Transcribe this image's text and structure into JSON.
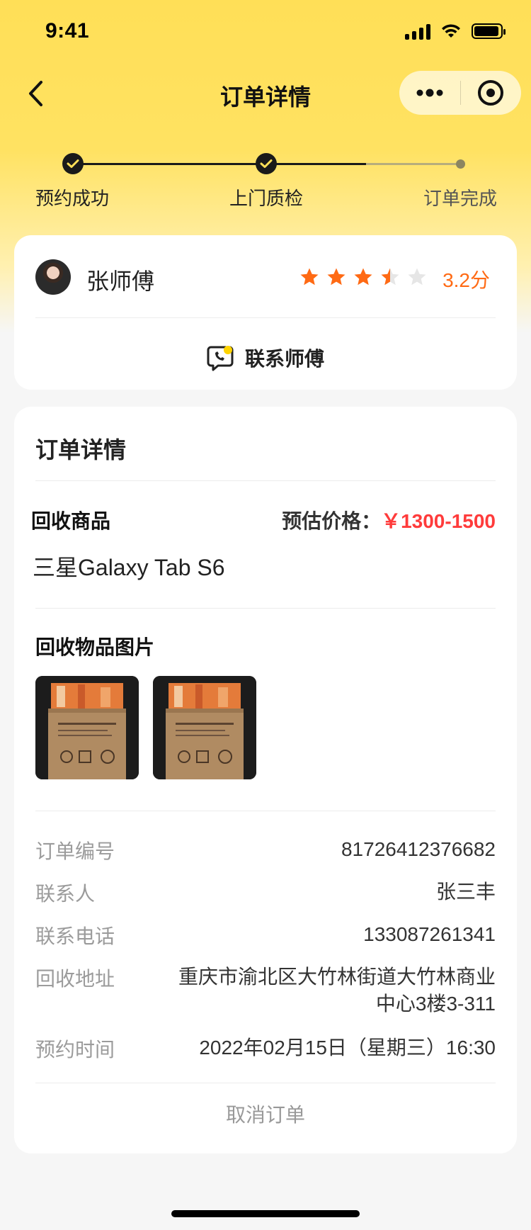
{
  "status_bar": {
    "time": "9:41"
  },
  "nav": {
    "title": "订单详情"
  },
  "progress": {
    "steps": [
      {
        "label": "预约成功",
        "state": "done"
      },
      {
        "label": "上门质检",
        "state": "done"
      },
      {
        "label": "订单完成",
        "state": "pending"
      }
    ]
  },
  "master": {
    "name": "张师傅",
    "rating": 3.2,
    "rating_text": "3.2分",
    "contact_label": "联系师傅"
  },
  "order": {
    "section_title": "订单详情",
    "goods_label": "回收商品",
    "price_label": "预估价格：",
    "price_value": "￥1300-1500",
    "goods_name": "三星Galaxy Tab S6",
    "images_title": "回收物品图片",
    "fields": [
      {
        "key": "订单编号",
        "value": "81726412376682"
      },
      {
        "key": "联系人",
        "value": "张三丰"
      },
      {
        "key": "联系电话",
        "value": "133087261341"
      },
      {
        "key": "回收地址",
        "value": "重庆市渝北区大竹林街道大竹林商业中心3楼3-311"
      },
      {
        "key": "预约时间",
        "value": "2022年02月15日（星期三）16:30"
      }
    ],
    "cancel_label": "取消订单"
  },
  "colors": {
    "brand": "#ffdf57",
    "accent_orange": "#ff6a14",
    "price_red": "#ff3b3b"
  }
}
